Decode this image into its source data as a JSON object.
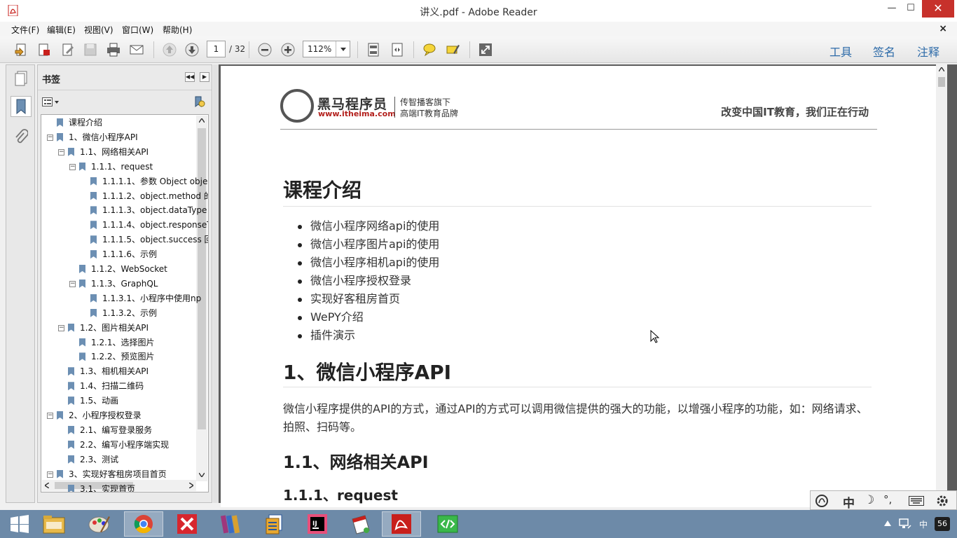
{
  "window": {
    "title": "讲义.pdf - Adobe Reader",
    "minimize": "—",
    "maximize": "☐",
    "close": "✕"
  },
  "menu": {
    "items": [
      "文件(F)",
      "编辑(E)",
      "视图(V)",
      "窗口(W)",
      "帮助(H)"
    ],
    "close": "×"
  },
  "toolbar": {
    "page_current": "1",
    "page_total": "/ 32",
    "zoom": "112%",
    "right_tools": [
      "工具",
      "签名",
      "注释"
    ]
  },
  "bookmarks": {
    "title": "书签",
    "items": [
      {
        "label": "课程介绍",
        "level": 0,
        "toggle": ""
      },
      {
        "label": "1、微信小程序API",
        "level": 0,
        "toggle": "−"
      },
      {
        "label": "1.1、网络相关API",
        "level": 1,
        "toggle": "−"
      },
      {
        "label": "1.1.1、request",
        "level": 2,
        "toggle": "−"
      },
      {
        "label": "1.1.1.1、参数 Object obje",
        "level": 3,
        "toggle": ""
      },
      {
        "label": "1.1.1.2、object.method 的",
        "level": 3,
        "toggle": ""
      },
      {
        "label": "1.1.1.3、object.dataType I",
        "level": 3,
        "toggle": ""
      },
      {
        "label": "1.1.1.4、object.responseT",
        "level": 3,
        "toggle": ""
      },
      {
        "label": "1.1.1.5、object.success 回",
        "level": 3,
        "toggle": ""
      },
      {
        "label": "1.1.1.6、示例",
        "level": 3,
        "toggle": ""
      },
      {
        "label": "1.1.2、WebSocket",
        "level": 2,
        "toggle": ""
      },
      {
        "label": "1.1.3、GraphQL",
        "level": 2,
        "toggle": "−"
      },
      {
        "label": "1.1.3.1、小程序中使用np",
        "level": 3,
        "toggle": ""
      },
      {
        "label": "1.1.3.2、示例",
        "level": 3,
        "toggle": ""
      },
      {
        "label": "1.2、图片相关API",
        "level": 1,
        "toggle": "−"
      },
      {
        "label": "1.2.1、选择图片",
        "level": 2,
        "toggle": ""
      },
      {
        "label": "1.2.2、预览图片",
        "level": 2,
        "toggle": ""
      },
      {
        "label": "1.3、相机相关API",
        "level": 1,
        "toggle": ""
      },
      {
        "label": "1.4、扫描二维码",
        "level": 1,
        "toggle": ""
      },
      {
        "label": "1.5、动画",
        "level": 1,
        "toggle": ""
      },
      {
        "label": "2、小程序授权登录",
        "level": 0,
        "toggle": "−"
      },
      {
        "label": "2.1、编写登录服务",
        "level": 1,
        "toggle": ""
      },
      {
        "label": "2.2、编写小程序端实现",
        "level": 1,
        "toggle": ""
      },
      {
        "label": "2.3、测试",
        "level": 1,
        "toggle": ""
      },
      {
        "label": "3、实现好客租房项目首页",
        "level": 0,
        "toggle": "−"
      },
      {
        "label": "3.1、实现首页",
        "level": 1,
        "toggle": ""
      }
    ]
  },
  "document": {
    "logo_name": "黑马程序员",
    "logo_url": "www.itheima.com",
    "logo_tag1": "传智播客旗下",
    "logo_tag2": "高端IT教育品牌",
    "slogan": "改变中国IT教育，我们正在行动",
    "h1_intro": "课程介绍",
    "bullets": [
      "微信小程序网络api的使用",
      "微信小程序图片api的使用",
      "微信小程序相机api的使用",
      "微信小程序授权登录",
      "实现好客租房首页",
      "WePY介绍",
      "插件演示"
    ],
    "h1_api": "1、微信小程序API",
    "paragraph": "微信小程序提供的API的方式，通过API的方式可以调用微信提供的强大的功能，以增强小程序的功能，如：网络请求、拍照、扫码等。",
    "h2": "1.1、网络相关API",
    "h3": "1.1.1、request"
  },
  "ime": {
    "lang": "中",
    "moon": "☽",
    "punct": "°,"
  },
  "tray": {
    "lang": "中",
    "badge": "56"
  },
  "colors": {
    "accent_blue": "#2c6aa8",
    "taskbar": "#6d8aa8",
    "adobe_red": "#c8201c"
  }
}
